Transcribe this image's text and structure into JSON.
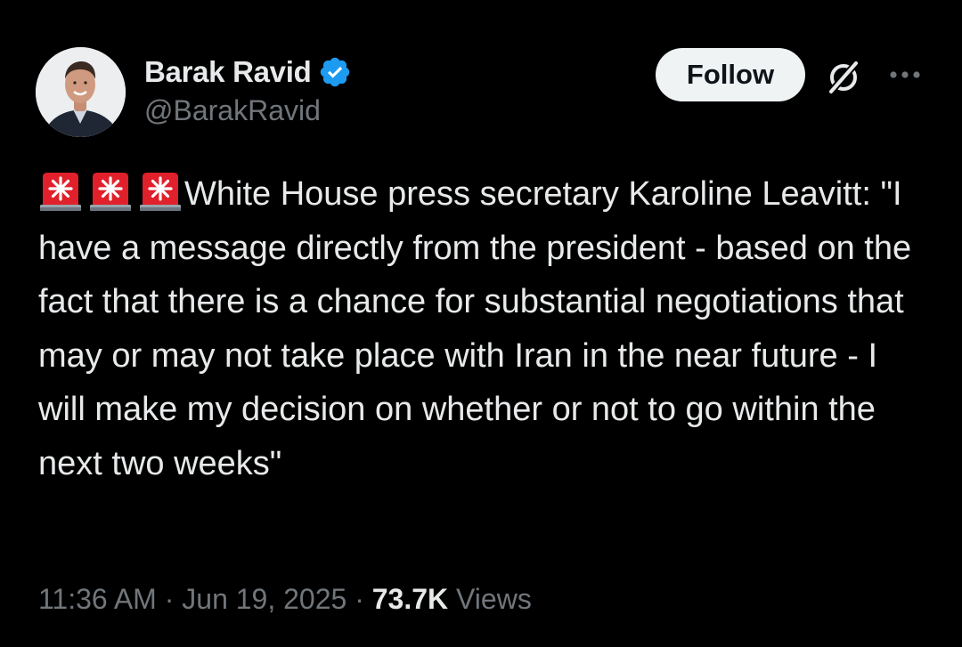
{
  "author": {
    "display_name": "Barak Ravid",
    "handle": "@BarakRavid",
    "verified": true,
    "verified_color": "#1d9bf0"
  },
  "actions": {
    "follow_label": "Follow",
    "grok_icon": "grok-icon",
    "more_icon": "more-icon"
  },
  "tweet": {
    "emoji_prefix": [
      "🚨",
      "🚨",
      "🚨"
    ],
    "text": "White House press secretary Karoline Leavitt: \"I have a message directly from the president - based on the fact that there is a chance for substantial negotiations that may or may not take place with Iran in the near future - I will make my decision on whether or not to go within the next two weeks\""
  },
  "meta": {
    "time": "11:36 AM",
    "separator": "·",
    "date": "Jun 19, 2025",
    "views_count": "73.7K",
    "views_label": "Views"
  }
}
